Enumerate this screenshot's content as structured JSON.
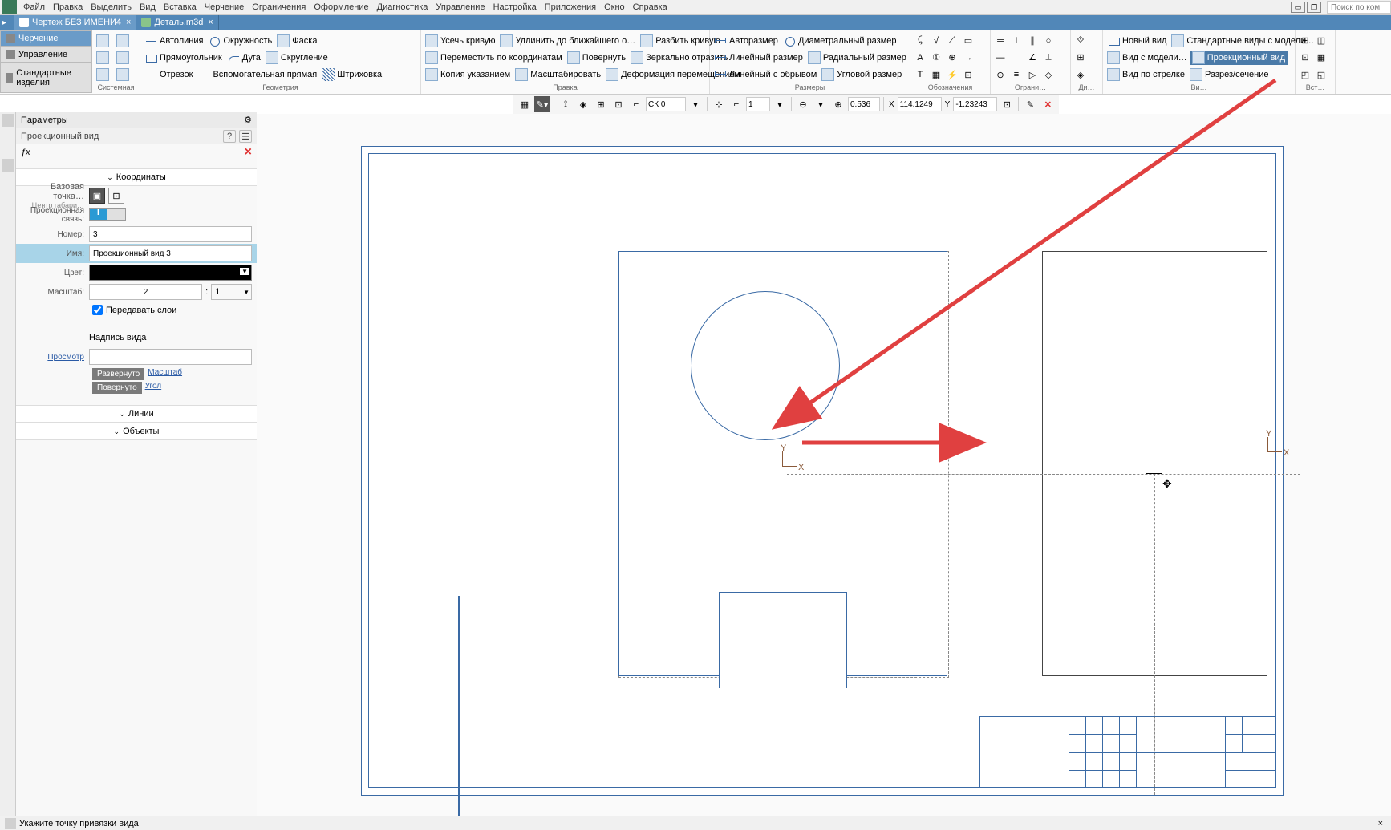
{
  "menu": [
    "Файл",
    "Правка",
    "Выделить",
    "Вид",
    "Вставка",
    "Черчение",
    "Ограничения",
    "Оформление",
    "Диагностика",
    "Управление",
    "Настройка",
    "Приложения",
    "Окно",
    "Справка"
  ],
  "search_placeholder": "Поиск по ком",
  "doctabs": [
    {
      "label": "Чертеж БЕЗ ИМЕНИ4",
      "active": true
    },
    {
      "label": "Деталь.m3d",
      "active": false
    }
  ],
  "mode_tabs": [
    {
      "label": "Черчение",
      "active": true
    },
    {
      "label": "Управление",
      "active": false
    },
    {
      "label": "Стандартные изделия",
      "active": false
    }
  ],
  "ribbon": {
    "sys_label": "Системная",
    "geom_label": "Геометрия",
    "edit_label": "Правка",
    "dim_label": "Размеры",
    "notes_label": "Обозначения",
    "constr_label": "Ограни…",
    "diag_label": "Ди…",
    "views_label": "Ви…",
    "insert_label": "Вст…",
    "autoline": "Автолиния",
    "circle": "Окружность",
    "chamfer": "Фаска",
    "rect": "Прямоугольник",
    "arc": "Дуга",
    "fillet": "Скругление",
    "seg": "Отрезок",
    "aux": "Вспомогательная прямая",
    "hatch": "Штриховка",
    "trim": "Усечь кривую",
    "extend": "Удлинить до ближайшего о…",
    "split": "Разбить кривую",
    "move": "Переместить по координатам",
    "rotate": "Повернуть",
    "mirror": "Зеркально отразить",
    "copy": "Копия указанием",
    "scale": "Масштабировать",
    "deform": "Деформация перемещением",
    "autodim": "Авторазмер",
    "diadim": "Диаметральный размер",
    "lindim": "Линейный размер",
    "raddim": "Радиальный размер",
    "breakdim": "Линейный с обрывом",
    "angdim": "Угловой размер",
    "newview": "Новый вид",
    "stdviews": "Стандартные виды с модели…",
    "modelview": "Вид с модели…",
    "projview": "Проекционный вид",
    "arrowview": "Вид по стрелке",
    "section": "Разрез/сечение"
  },
  "subbar": {
    "ck": "СК 0",
    "step": "1",
    "zoom": "0.536",
    "x_label": "X",
    "x": "114.1249",
    "y_label": "Y",
    "y": "-1.23243"
  },
  "panel": {
    "title": "Параметры",
    "subtitle": "Проекционный вид",
    "coords": "Координаты",
    "basepoint_label": "Базовая точка…",
    "center_label": "Центр габари…",
    "proj_link_label": "Проекционная связь:",
    "number_label": "Номер:",
    "number_value": "3",
    "name_label": "Имя:",
    "name_value": "Проекционный вид 3",
    "color_label": "Цвет:",
    "scale_label": "Масштаб:",
    "scale_a": "2",
    "scale_b": "1",
    "layers_checkbox": "Передавать слои",
    "caption_label": "Надпись вида",
    "preview": "Просмотр",
    "expanded": "Развернуто",
    "expanded_link": "Масштаб",
    "rotated": "Повернуто",
    "rotated_link": "Угол",
    "lines": "Линии",
    "objects": "Объекты"
  },
  "status": "Укажите точку привязки вида",
  "axis": {
    "x": "X",
    "y": "Y"
  }
}
